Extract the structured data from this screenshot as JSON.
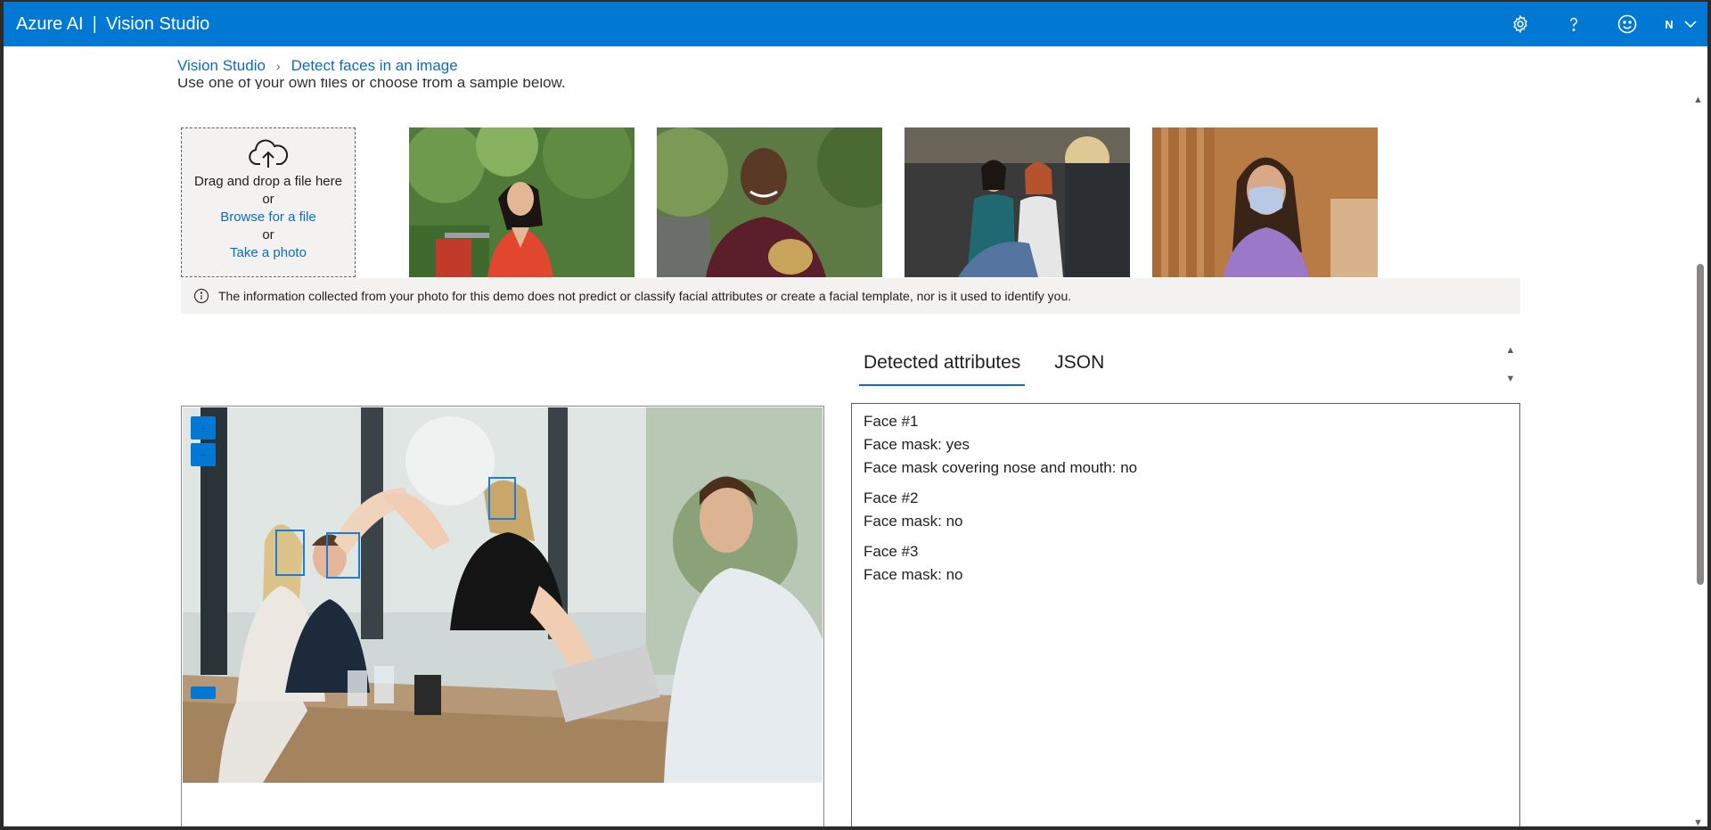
{
  "header": {
    "brand_left": "Azure AI",
    "brand_sep": "|",
    "brand_right": "Vision Studio",
    "avatar_initial": "N"
  },
  "breadcrumb": {
    "root": "Vision Studio",
    "current": "Detect faces in an image"
  },
  "intro_text": "Use one of your own files or choose from a sample below.",
  "upload": {
    "drag_text": "Drag and drop a file here",
    "or1": "or",
    "browse": "Browse for a file",
    "or2": "or",
    "photo": "Take a photo"
  },
  "info": {
    "text": "The information collected from your photo for this demo does not predict or classify facial attributes or create a facial template, nor is it used to identify you."
  },
  "tabs": {
    "detected": "Detected attributes",
    "json": "JSON"
  },
  "results": {
    "face1_title": "Face #1",
    "face1_mask": "Face mask: yes",
    "face1_cover": "Face mask covering nose and mouth: no",
    "face2_title": "Face #2",
    "face2_mask": "Face mask: no",
    "face3_title": "Face #3",
    "face3_mask": "Face mask: no"
  },
  "colors": {
    "accent": "#0078d4",
    "link": "#0f6cbd",
    "face_box": "#1a7ed8"
  }
}
